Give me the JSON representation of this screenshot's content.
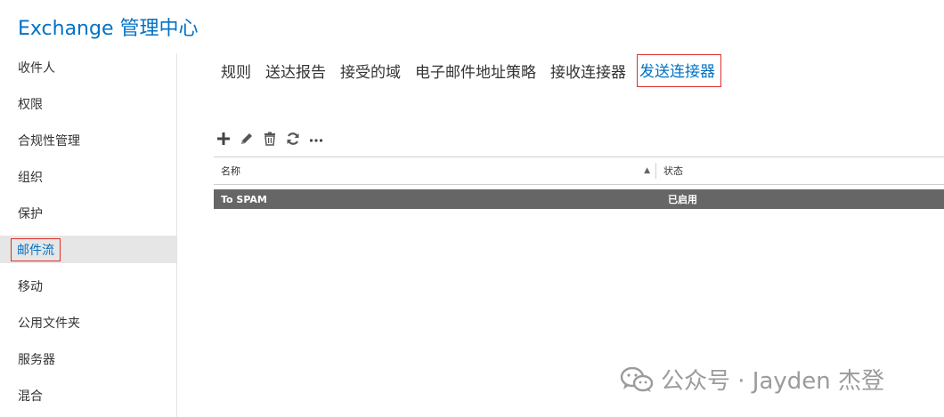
{
  "app": {
    "title": "Exchange 管理中心"
  },
  "sidebar": {
    "items": [
      {
        "label": "收件人"
      },
      {
        "label": "权限"
      },
      {
        "label": "合规性管理"
      },
      {
        "label": "组织"
      },
      {
        "label": "保护"
      },
      {
        "label": "邮件流",
        "active": true
      },
      {
        "label": "移动"
      },
      {
        "label": "公用文件夹"
      },
      {
        "label": "服务器"
      },
      {
        "label": "混合"
      }
    ]
  },
  "tabs": [
    {
      "label": "规则"
    },
    {
      "label": "送达报告"
    },
    {
      "label": "接受的域"
    },
    {
      "label": "电子邮件地址策略"
    },
    {
      "label": "接收连接器"
    },
    {
      "label": "发送连接器",
      "active": true
    }
  ],
  "toolbar": {
    "icons": [
      "add-icon",
      "edit-icon",
      "delete-icon",
      "refresh-icon",
      "more-icon"
    ]
  },
  "table": {
    "columns": [
      "名称",
      "状态"
    ],
    "sort": "ascending",
    "rows": [
      {
        "name": "To SPAM",
        "status": "已启用",
        "selected": true
      }
    ]
  },
  "watermark": {
    "text": "公众号 · Jayden 杰登"
  },
  "colors": {
    "accent": "#0072c6",
    "highlight_border": "#d9302c",
    "selected_row": "#666666"
  }
}
